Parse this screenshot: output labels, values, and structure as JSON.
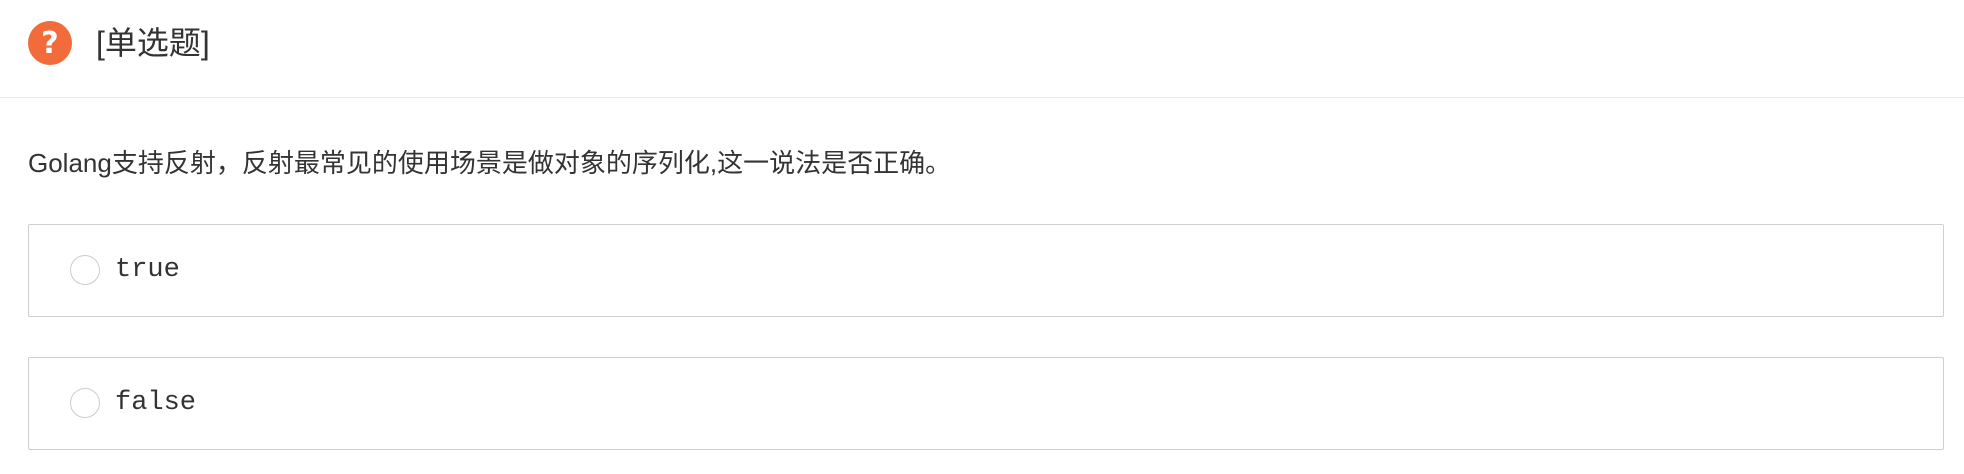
{
  "header": {
    "icon": "question-mark-icon",
    "icon_glyph": "?",
    "icon_color": "#f26b3a",
    "question_type": "[单选题]"
  },
  "question": {
    "stem": "Golang支持反射，反射最常见的使用场景是做对象的序列化,这一说法是否正确。"
  },
  "options": [
    {
      "label": "true",
      "selected": false
    },
    {
      "label": "false",
      "selected": false
    }
  ]
}
